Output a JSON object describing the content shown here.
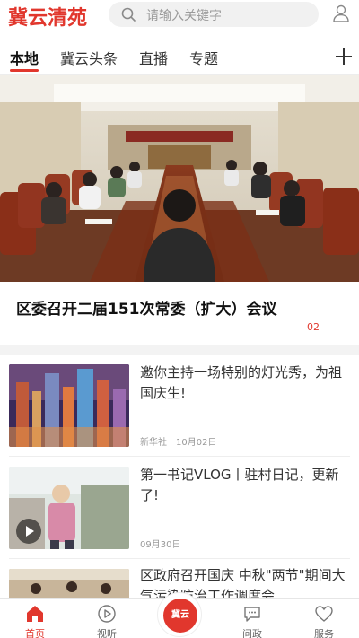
{
  "app": {
    "logo": "冀云清苑"
  },
  "search": {
    "placeholder": "请输入关键字"
  },
  "tabs": [
    {
      "label": "本地",
      "active": true
    },
    {
      "label": "冀云头条",
      "active": false
    },
    {
      "label": "直播",
      "active": false
    },
    {
      "label": "专题",
      "active": false
    }
  ],
  "hero": {
    "title": "区委召开二届151次常委（扩大）会议",
    "pager": "02"
  },
  "news": [
    {
      "title": "邀你主持一场特别的灯光秀，为祖国庆生!",
      "source": "新华社",
      "date": "10月02日",
      "has_video": false
    },
    {
      "title": "第一书记VLOG丨驻村日记，更新了!",
      "source": "",
      "date": "09月30日",
      "has_video": true
    },
    {
      "title": "区政府召开国庆 中秋\"两节\"期间大气污染防治工作调度会",
      "source": "",
      "date": "",
      "has_video": false
    }
  ],
  "bottom_nav": [
    {
      "label": "首页",
      "icon": "home-icon",
      "active": true
    },
    {
      "label": "视听",
      "icon": "play-circle-icon",
      "active": false
    },
    {
      "label": "问政",
      "icon": "chat-bubble-icon",
      "active": false
    },
    {
      "label": "服务",
      "icon": "heart-icon",
      "active": false
    }
  ],
  "center_badge": {
    "label": "冀云"
  },
  "colors": {
    "brand": "#e1372d",
    "muted": "#999999",
    "divider": "#f3f3f3"
  }
}
